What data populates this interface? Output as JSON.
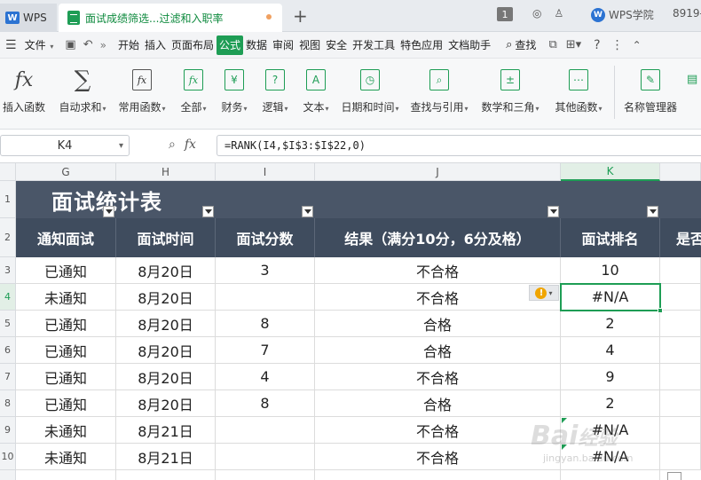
{
  "tabs": {
    "wps_home": "WPS",
    "document": "面试成绩筛选...过滤和入职率",
    "new_tab": "+",
    "count_badge": "1",
    "wps_academy": "WPS学院",
    "user_id": "8919-"
  },
  "menu": {
    "file": "文件",
    "items": [
      "开始",
      "插入",
      "页面布局",
      "公式",
      "数据",
      "审阅",
      "视图",
      "安全",
      "开发工具",
      "特色应用",
      "文档助手"
    ],
    "active": "公式",
    "search": "查找"
  },
  "ribbon": {
    "buttons": [
      {
        "label": "插入函数",
        "icon": "fx-icon"
      },
      {
        "label": "自动求和",
        "icon": "sigma-icon"
      },
      {
        "label": "常用函数",
        "icon": "star-fx-icon"
      },
      {
        "label": "全部",
        "icon": "book-fx-icon"
      },
      {
        "label": "财务",
        "icon": "yen-icon"
      },
      {
        "label": "逻辑",
        "icon": "question-icon"
      },
      {
        "label": "文本",
        "icon": "text-a-icon"
      },
      {
        "label": "日期和时间",
        "icon": "clock-icon"
      },
      {
        "label": "查找与引用",
        "icon": "search-book-icon"
      },
      {
        "label": "数学和三角",
        "icon": "math-icon"
      },
      {
        "label": "其他函数",
        "icon": "more-icon"
      },
      {
        "label": "名称管理器",
        "icon": "name-manager-icon"
      }
    ]
  },
  "formula_bar": {
    "cell_ref": "K4",
    "formula": "=RANK(I4,$I$3:$I$22,0)"
  },
  "columns": [
    "G",
    "H",
    "I",
    "J",
    "K"
  ],
  "selected_column": "K",
  "rows": [
    "1",
    "2",
    "3",
    "4",
    "5",
    "6",
    "7",
    "8",
    "9",
    "10"
  ],
  "selected_row": "4",
  "sheet": {
    "title": "面试统计表",
    "headers": [
      "通知面试",
      "面试时间",
      "面试分数",
      "结果（满分10分，6分及格）",
      "面试排名",
      "是否"
    ],
    "data": [
      [
        "已通知",
        "8月20日",
        "3",
        "不合格",
        "10"
      ],
      [
        "未通知",
        "8月20日",
        "",
        "不合格",
        "#N/A"
      ],
      [
        "已通知",
        "8月20日",
        "8",
        "合格",
        "2"
      ],
      [
        "已通知",
        "8月20日",
        "7",
        "合格",
        "4"
      ],
      [
        "已通知",
        "8月20日",
        "4",
        "不合格",
        "9"
      ],
      [
        "已通知",
        "8月20日",
        "8",
        "合格",
        "2"
      ],
      [
        "未通知",
        "8月21日",
        "",
        "不合格",
        "#N/A"
      ],
      [
        "未通知",
        "8月21日",
        "",
        "不合格",
        "#N/A"
      ]
    ]
  },
  "colors": {
    "accent_green": "#1e9d55",
    "title_band": "#4a5668",
    "header_band": "#3f4c5e",
    "warning": "#f0a500"
  }
}
